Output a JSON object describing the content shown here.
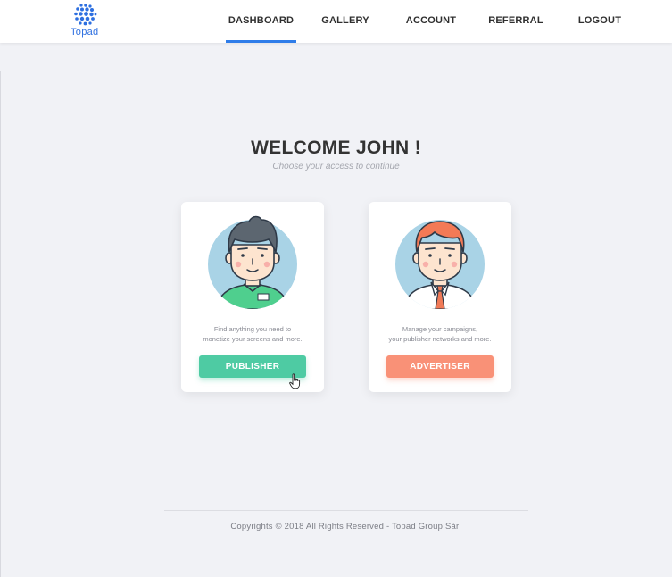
{
  "brand": {
    "name": "Topad",
    "color": "#2d6fe0"
  },
  "nav": {
    "items": [
      {
        "label": "DASHBOARD",
        "active": true
      },
      {
        "label": "GALLERY",
        "active": false
      },
      {
        "label": "ACCOUNT",
        "active": false
      },
      {
        "label": "REFERRAL",
        "active": false
      },
      {
        "label": "LOGOUT",
        "active": false
      }
    ],
    "active_color": "#2f7de9"
  },
  "main": {
    "title": "WELCOME JOHN !",
    "subtitle": "Choose your access to continue"
  },
  "cards": [
    {
      "role": "publisher",
      "description_lines": [
        "Find anything you need to",
        "monetize your screens and more."
      ],
      "button_label": "PUBLISHER",
      "button_color": "#4ecba3"
    },
    {
      "role": "advertiser",
      "description_lines": [
        "Manage your campaigns,",
        "your publisher networks and more."
      ],
      "button_label": "ADVERTISER",
      "button_color": "#f99177"
    }
  ],
  "footer": {
    "text": "Copyrights © 2018 All Rights Reserved - Topad Group Sàrl"
  }
}
